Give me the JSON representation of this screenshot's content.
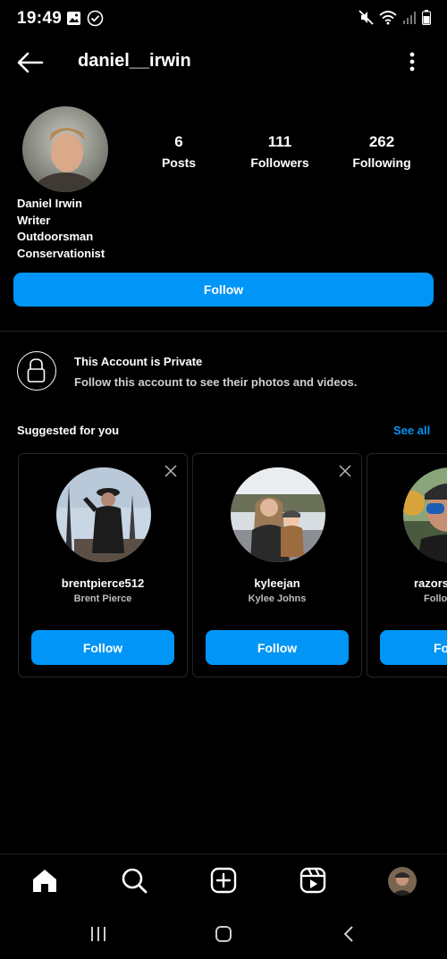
{
  "status_bar": {
    "time": "19:49"
  },
  "header": {
    "username": "daniel__irwin"
  },
  "profile": {
    "stats": [
      {
        "value": "6",
        "label": "Posts"
      },
      {
        "value": "111",
        "label": "Followers"
      },
      {
        "value": "262",
        "label": "Following"
      }
    ],
    "bio": [
      "Daniel Irwin",
      "Writer",
      "Outdoorsman",
      "Conservationist"
    ],
    "follow_label": "Follow"
  },
  "private_notice": {
    "title": "This Account is Private",
    "subtitle": "Follow this account to see their photos and videos."
  },
  "suggested": {
    "heading": "Suggested for you",
    "see_all": "See all",
    "cards": [
      {
        "username": "brentpierce512",
        "name": "Brent Pierce",
        "follow": "Follow"
      },
      {
        "username": "kyleejan",
        "name": "Kylee Johns",
        "follow": "Follow"
      },
      {
        "username": "razors",
        "name": "Follo",
        "follow": "Fo"
      }
    ]
  },
  "bottom_nav": [
    "home-icon",
    "search-icon",
    "create-icon",
    "reels-icon",
    "profile-avatar"
  ],
  "colors": {
    "accent": "#0095f6",
    "background": "#000000",
    "divider": "#262626"
  }
}
